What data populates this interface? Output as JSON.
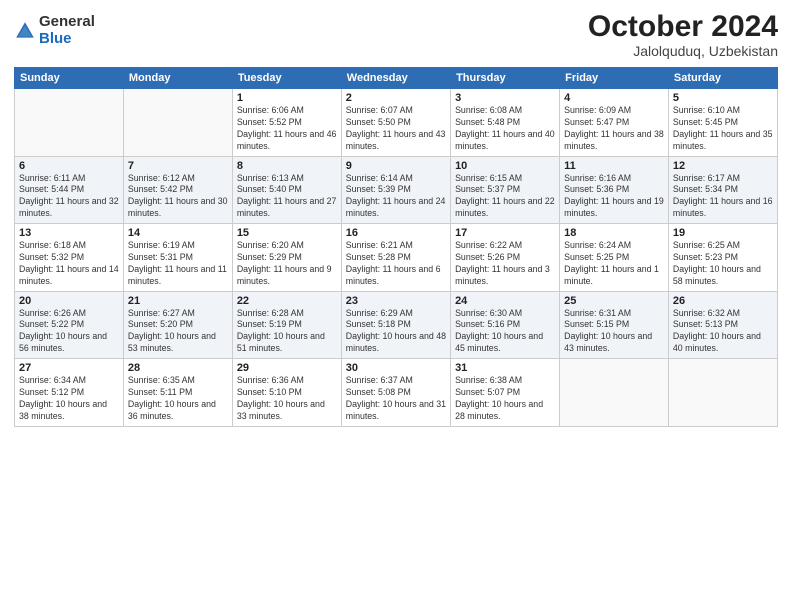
{
  "logo": {
    "general": "General",
    "blue": "Blue"
  },
  "title": "October 2024",
  "location": "Jalolquduq, Uzbekistan",
  "weekdays": [
    "Sunday",
    "Monday",
    "Tuesday",
    "Wednesday",
    "Thursday",
    "Friday",
    "Saturday"
  ],
  "weeks": [
    [
      {
        "day": "",
        "sunrise": "",
        "sunset": "",
        "daylight": ""
      },
      {
        "day": "",
        "sunrise": "",
        "sunset": "",
        "daylight": ""
      },
      {
        "day": "1",
        "sunrise": "Sunrise: 6:06 AM",
        "sunset": "Sunset: 5:52 PM",
        "daylight": "Daylight: 11 hours and 46 minutes."
      },
      {
        "day": "2",
        "sunrise": "Sunrise: 6:07 AM",
        "sunset": "Sunset: 5:50 PM",
        "daylight": "Daylight: 11 hours and 43 minutes."
      },
      {
        "day": "3",
        "sunrise": "Sunrise: 6:08 AM",
        "sunset": "Sunset: 5:48 PM",
        "daylight": "Daylight: 11 hours and 40 minutes."
      },
      {
        "day": "4",
        "sunrise": "Sunrise: 6:09 AM",
        "sunset": "Sunset: 5:47 PM",
        "daylight": "Daylight: 11 hours and 38 minutes."
      },
      {
        "day": "5",
        "sunrise": "Sunrise: 6:10 AM",
        "sunset": "Sunset: 5:45 PM",
        "daylight": "Daylight: 11 hours and 35 minutes."
      }
    ],
    [
      {
        "day": "6",
        "sunrise": "Sunrise: 6:11 AM",
        "sunset": "Sunset: 5:44 PM",
        "daylight": "Daylight: 11 hours and 32 minutes."
      },
      {
        "day": "7",
        "sunrise": "Sunrise: 6:12 AM",
        "sunset": "Sunset: 5:42 PM",
        "daylight": "Daylight: 11 hours and 30 minutes."
      },
      {
        "day": "8",
        "sunrise": "Sunrise: 6:13 AM",
        "sunset": "Sunset: 5:40 PM",
        "daylight": "Daylight: 11 hours and 27 minutes."
      },
      {
        "day": "9",
        "sunrise": "Sunrise: 6:14 AM",
        "sunset": "Sunset: 5:39 PM",
        "daylight": "Daylight: 11 hours and 24 minutes."
      },
      {
        "day": "10",
        "sunrise": "Sunrise: 6:15 AM",
        "sunset": "Sunset: 5:37 PM",
        "daylight": "Daylight: 11 hours and 22 minutes."
      },
      {
        "day": "11",
        "sunrise": "Sunrise: 6:16 AM",
        "sunset": "Sunset: 5:36 PM",
        "daylight": "Daylight: 11 hours and 19 minutes."
      },
      {
        "day": "12",
        "sunrise": "Sunrise: 6:17 AM",
        "sunset": "Sunset: 5:34 PM",
        "daylight": "Daylight: 11 hours and 16 minutes."
      }
    ],
    [
      {
        "day": "13",
        "sunrise": "Sunrise: 6:18 AM",
        "sunset": "Sunset: 5:32 PM",
        "daylight": "Daylight: 11 hours and 14 minutes."
      },
      {
        "day": "14",
        "sunrise": "Sunrise: 6:19 AM",
        "sunset": "Sunset: 5:31 PM",
        "daylight": "Daylight: 11 hours and 11 minutes."
      },
      {
        "day": "15",
        "sunrise": "Sunrise: 6:20 AM",
        "sunset": "Sunset: 5:29 PM",
        "daylight": "Daylight: 11 hours and 9 minutes."
      },
      {
        "day": "16",
        "sunrise": "Sunrise: 6:21 AM",
        "sunset": "Sunset: 5:28 PM",
        "daylight": "Daylight: 11 hours and 6 minutes."
      },
      {
        "day": "17",
        "sunrise": "Sunrise: 6:22 AM",
        "sunset": "Sunset: 5:26 PM",
        "daylight": "Daylight: 11 hours and 3 minutes."
      },
      {
        "day": "18",
        "sunrise": "Sunrise: 6:24 AM",
        "sunset": "Sunset: 5:25 PM",
        "daylight": "Daylight: 11 hours and 1 minute."
      },
      {
        "day": "19",
        "sunrise": "Sunrise: 6:25 AM",
        "sunset": "Sunset: 5:23 PM",
        "daylight": "Daylight: 10 hours and 58 minutes."
      }
    ],
    [
      {
        "day": "20",
        "sunrise": "Sunrise: 6:26 AM",
        "sunset": "Sunset: 5:22 PM",
        "daylight": "Daylight: 10 hours and 56 minutes."
      },
      {
        "day": "21",
        "sunrise": "Sunrise: 6:27 AM",
        "sunset": "Sunset: 5:20 PM",
        "daylight": "Daylight: 10 hours and 53 minutes."
      },
      {
        "day": "22",
        "sunrise": "Sunrise: 6:28 AM",
        "sunset": "Sunset: 5:19 PM",
        "daylight": "Daylight: 10 hours and 51 minutes."
      },
      {
        "day": "23",
        "sunrise": "Sunrise: 6:29 AM",
        "sunset": "Sunset: 5:18 PM",
        "daylight": "Daylight: 10 hours and 48 minutes."
      },
      {
        "day": "24",
        "sunrise": "Sunrise: 6:30 AM",
        "sunset": "Sunset: 5:16 PM",
        "daylight": "Daylight: 10 hours and 45 minutes."
      },
      {
        "day": "25",
        "sunrise": "Sunrise: 6:31 AM",
        "sunset": "Sunset: 5:15 PM",
        "daylight": "Daylight: 10 hours and 43 minutes."
      },
      {
        "day": "26",
        "sunrise": "Sunrise: 6:32 AM",
        "sunset": "Sunset: 5:13 PM",
        "daylight": "Daylight: 10 hours and 40 minutes."
      }
    ],
    [
      {
        "day": "27",
        "sunrise": "Sunrise: 6:34 AM",
        "sunset": "Sunset: 5:12 PM",
        "daylight": "Daylight: 10 hours and 38 minutes."
      },
      {
        "day": "28",
        "sunrise": "Sunrise: 6:35 AM",
        "sunset": "Sunset: 5:11 PM",
        "daylight": "Daylight: 10 hours and 36 minutes."
      },
      {
        "day": "29",
        "sunrise": "Sunrise: 6:36 AM",
        "sunset": "Sunset: 5:10 PM",
        "daylight": "Daylight: 10 hours and 33 minutes."
      },
      {
        "day": "30",
        "sunrise": "Sunrise: 6:37 AM",
        "sunset": "Sunset: 5:08 PM",
        "daylight": "Daylight: 10 hours and 31 minutes."
      },
      {
        "day": "31",
        "sunrise": "Sunrise: 6:38 AM",
        "sunset": "Sunset: 5:07 PM",
        "daylight": "Daylight: 10 hours and 28 minutes."
      },
      {
        "day": "",
        "sunrise": "",
        "sunset": "",
        "daylight": ""
      },
      {
        "day": "",
        "sunrise": "",
        "sunset": "",
        "daylight": ""
      }
    ]
  ]
}
